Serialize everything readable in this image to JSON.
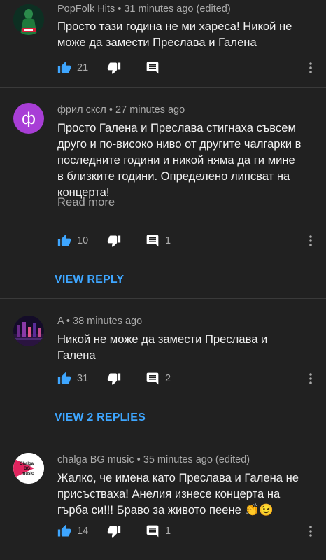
{
  "comments": [
    {
      "author": "PopFolk Hits",
      "time": "31 minutes ago (edited)",
      "text": "Просто тази година не ми хареса! Никой не може да замести Преслава и Галена",
      "likes": "21",
      "replies": "",
      "avatar": {
        "type": "image",
        "colors": [
          "#0e3b2a",
          "#1f7a3c",
          "#d81e3c"
        ]
      }
    },
    {
      "author": "фрил скcл",
      "time": "27 minutes ago",
      "text": "Просто Галена и Преслава стигнаха съвсем друго и по-високо ниво от другите чалгарки в последните години и никой няма да ги мине в близките години. Определено липсват на концерта!",
      "read_more": "Read more",
      "likes": "10",
      "replies": "1",
      "view_replies": "VIEW REPLY",
      "avatar": {
        "type": "letter",
        "letter": "ф",
        "color": "#a83ed6"
      }
    },
    {
      "author": "A",
      "time": "38 minutes ago",
      "text": "Никой не може да замести Преслава и Галена",
      "likes": "31",
      "replies": "2",
      "view_replies": "VIEW 2 REPLIES",
      "avatar": {
        "type": "image",
        "colors": [
          "#1a1030",
          "#6a2a8a",
          "#e2558a"
        ]
      }
    },
    {
      "author": "chalga BG music",
      "time": "35 minutes ago (edited)",
      "text": "Жалко, че имена като Преслава и Галена не присъстваха! Анелия изнесе концерта на гърба си!!! Браво за живото пеене 👏😉",
      "likes": "14",
      "replies": "1",
      "avatar": {
        "type": "logo",
        "text_lines": [
          "Chalga",
          "BG",
          "music"
        ],
        "bg": "#ffffff",
        "shape": "#e0245e"
      }
    }
  ],
  "separator": " • ",
  "colors": {
    "background": "#212121",
    "accent": "#3ea6ff",
    "text": "#f1f1f1",
    "muted": "#aaaaaa"
  }
}
